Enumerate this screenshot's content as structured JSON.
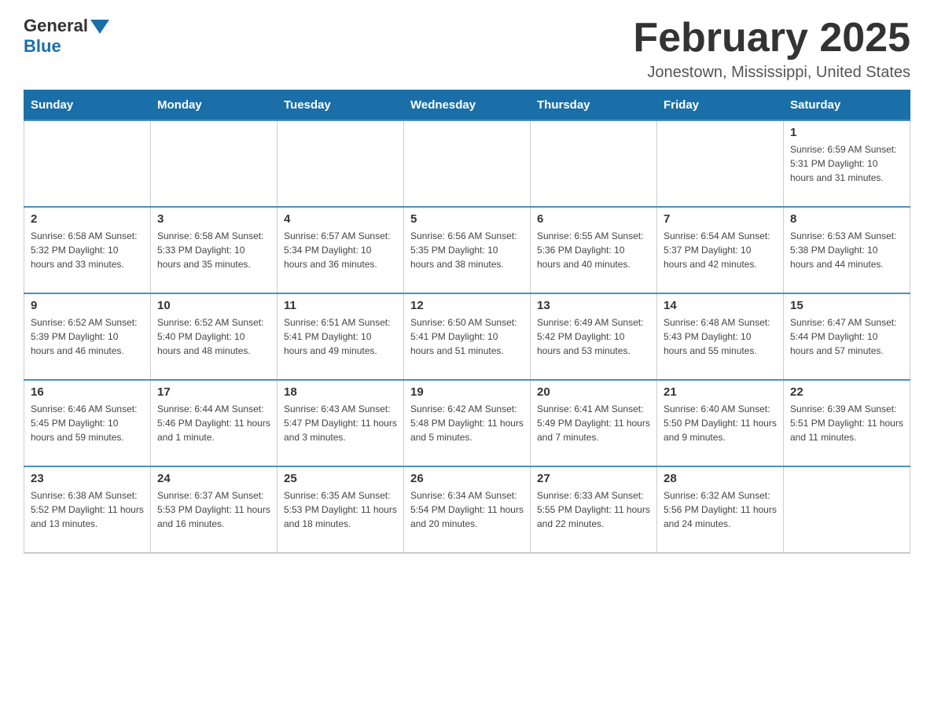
{
  "header": {
    "logo_general": "General",
    "logo_blue": "Blue",
    "main_title": "February 2025",
    "subtitle": "Jonestown, Mississippi, United States"
  },
  "calendar": {
    "days_of_week": [
      "Sunday",
      "Monday",
      "Tuesday",
      "Wednesday",
      "Thursday",
      "Friday",
      "Saturday"
    ],
    "weeks": [
      [
        {
          "day": "",
          "info": ""
        },
        {
          "day": "",
          "info": ""
        },
        {
          "day": "",
          "info": ""
        },
        {
          "day": "",
          "info": ""
        },
        {
          "day": "",
          "info": ""
        },
        {
          "day": "",
          "info": ""
        },
        {
          "day": "1",
          "info": "Sunrise: 6:59 AM\nSunset: 5:31 PM\nDaylight: 10 hours and 31 minutes."
        }
      ],
      [
        {
          "day": "2",
          "info": "Sunrise: 6:58 AM\nSunset: 5:32 PM\nDaylight: 10 hours and 33 minutes."
        },
        {
          "day": "3",
          "info": "Sunrise: 6:58 AM\nSunset: 5:33 PM\nDaylight: 10 hours and 35 minutes."
        },
        {
          "day": "4",
          "info": "Sunrise: 6:57 AM\nSunset: 5:34 PM\nDaylight: 10 hours and 36 minutes."
        },
        {
          "day": "5",
          "info": "Sunrise: 6:56 AM\nSunset: 5:35 PM\nDaylight: 10 hours and 38 minutes."
        },
        {
          "day": "6",
          "info": "Sunrise: 6:55 AM\nSunset: 5:36 PM\nDaylight: 10 hours and 40 minutes."
        },
        {
          "day": "7",
          "info": "Sunrise: 6:54 AM\nSunset: 5:37 PM\nDaylight: 10 hours and 42 minutes."
        },
        {
          "day": "8",
          "info": "Sunrise: 6:53 AM\nSunset: 5:38 PM\nDaylight: 10 hours and 44 minutes."
        }
      ],
      [
        {
          "day": "9",
          "info": "Sunrise: 6:52 AM\nSunset: 5:39 PM\nDaylight: 10 hours and 46 minutes."
        },
        {
          "day": "10",
          "info": "Sunrise: 6:52 AM\nSunset: 5:40 PM\nDaylight: 10 hours and 48 minutes."
        },
        {
          "day": "11",
          "info": "Sunrise: 6:51 AM\nSunset: 5:41 PM\nDaylight: 10 hours and 49 minutes."
        },
        {
          "day": "12",
          "info": "Sunrise: 6:50 AM\nSunset: 5:41 PM\nDaylight: 10 hours and 51 minutes."
        },
        {
          "day": "13",
          "info": "Sunrise: 6:49 AM\nSunset: 5:42 PM\nDaylight: 10 hours and 53 minutes."
        },
        {
          "day": "14",
          "info": "Sunrise: 6:48 AM\nSunset: 5:43 PM\nDaylight: 10 hours and 55 minutes."
        },
        {
          "day": "15",
          "info": "Sunrise: 6:47 AM\nSunset: 5:44 PM\nDaylight: 10 hours and 57 minutes."
        }
      ],
      [
        {
          "day": "16",
          "info": "Sunrise: 6:46 AM\nSunset: 5:45 PM\nDaylight: 10 hours and 59 minutes."
        },
        {
          "day": "17",
          "info": "Sunrise: 6:44 AM\nSunset: 5:46 PM\nDaylight: 11 hours and 1 minute."
        },
        {
          "day": "18",
          "info": "Sunrise: 6:43 AM\nSunset: 5:47 PM\nDaylight: 11 hours and 3 minutes."
        },
        {
          "day": "19",
          "info": "Sunrise: 6:42 AM\nSunset: 5:48 PM\nDaylight: 11 hours and 5 minutes."
        },
        {
          "day": "20",
          "info": "Sunrise: 6:41 AM\nSunset: 5:49 PM\nDaylight: 11 hours and 7 minutes."
        },
        {
          "day": "21",
          "info": "Sunrise: 6:40 AM\nSunset: 5:50 PM\nDaylight: 11 hours and 9 minutes."
        },
        {
          "day": "22",
          "info": "Sunrise: 6:39 AM\nSunset: 5:51 PM\nDaylight: 11 hours and 11 minutes."
        }
      ],
      [
        {
          "day": "23",
          "info": "Sunrise: 6:38 AM\nSunset: 5:52 PM\nDaylight: 11 hours and 13 minutes."
        },
        {
          "day": "24",
          "info": "Sunrise: 6:37 AM\nSunset: 5:53 PM\nDaylight: 11 hours and 16 minutes."
        },
        {
          "day": "25",
          "info": "Sunrise: 6:35 AM\nSunset: 5:53 PM\nDaylight: 11 hours and 18 minutes."
        },
        {
          "day": "26",
          "info": "Sunrise: 6:34 AM\nSunset: 5:54 PM\nDaylight: 11 hours and 20 minutes."
        },
        {
          "day": "27",
          "info": "Sunrise: 6:33 AM\nSunset: 5:55 PM\nDaylight: 11 hours and 22 minutes."
        },
        {
          "day": "28",
          "info": "Sunrise: 6:32 AM\nSunset: 5:56 PM\nDaylight: 11 hours and 24 minutes."
        },
        {
          "day": "",
          "info": ""
        }
      ]
    ]
  }
}
